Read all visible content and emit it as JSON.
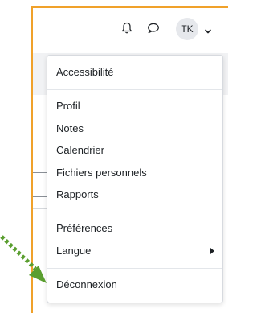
{
  "colors": {
    "annotation_border": "#f0a12a",
    "arrow": "#5a9e2f",
    "text": "#1d2125",
    "menu_border": "#d7dadf"
  },
  "navbar": {
    "notifications_icon": "bell-icon",
    "messages_icon": "chat-bubble-icon",
    "user_initials": "TK",
    "user_menu_icon": "chevron-down-icon"
  },
  "user_menu": {
    "items": [
      {
        "label": "Accessibilité"
      },
      {
        "label": "Profil"
      },
      {
        "label": "Notes"
      },
      {
        "label": "Calendrier"
      },
      {
        "label": "Fichiers personnels"
      },
      {
        "label": "Rapports"
      },
      {
        "label": "Préférences"
      },
      {
        "label": "Langue",
        "submenu_icon": "caret-right-icon"
      },
      {
        "label": "Déconnexion"
      }
    ]
  },
  "annotation": {
    "icon": "dotted-arrow-icon"
  }
}
